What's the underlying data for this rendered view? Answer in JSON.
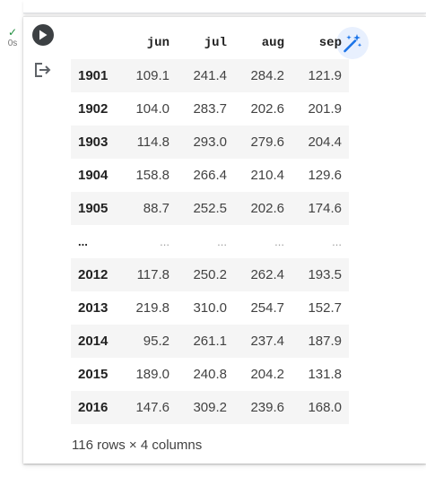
{
  "execution": {
    "status_icon": "✓",
    "time": "0s"
  },
  "toolbar": {
    "run_icon": "play-icon",
    "output_icon": "output-icon",
    "magic_icon": "magic-wand-icon"
  },
  "table": {
    "columns": [
      "jun",
      "jul",
      "aug",
      "sep"
    ],
    "rows": [
      {
        "index": "1901",
        "values": [
          "109.1",
          "241.4",
          "284.2",
          "121.9"
        ]
      },
      {
        "index": "1902",
        "values": [
          "104.0",
          "283.7",
          "202.6",
          "201.9"
        ]
      },
      {
        "index": "1903",
        "values": [
          "114.8",
          "293.0",
          "279.6",
          "204.4"
        ]
      },
      {
        "index": "1904",
        "values": [
          "158.8",
          "266.4",
          "210.4",
          "129.6"
        ]
      },
      {
        "index": "1905",
        "values": [
          "88.7",
          "252.5",
          "202.6",
          "174.6"
        ]
      },
      {
        "index": "...",
        "values": [
          "...",
          "...",
          "...",
          "..."
        ]
      },
      {
        "index": "2012",
        "values": [
          "117.8",
          "250.2",
          "262.4",
          "193.5"
        ]
      },
      {
        "index": "2013",
        "values": [
          "219.8",
          "310.0",
          "254.7",
          "152.7"
        ]
      },
      {
        "index": "2014",
        "values": [
          "95.2",
          "261.1",
          "237.4",
          "187.9"
        ]
      },
      {
        "index": "2015",
        "values": [
          "189.0",
          "240.8",
          "204.2",
          "131.8"
        ]
      },
      {
        "index": "2016",
        "values": [
          "147.6",
          "309.2",
          "239.6",
          "168.0"
        ]
      }
    ]
  },
  "shape_text": "116 rows × 4 columns",
  "colors": {
    "check": "#1e8e3e",
    "run_button": "#3c4043",
    "magic_bg": "#e8f0fe",
    "magic_icon": "#1a73e8",
    "stripe": "#f5f5f5"
  }
}
